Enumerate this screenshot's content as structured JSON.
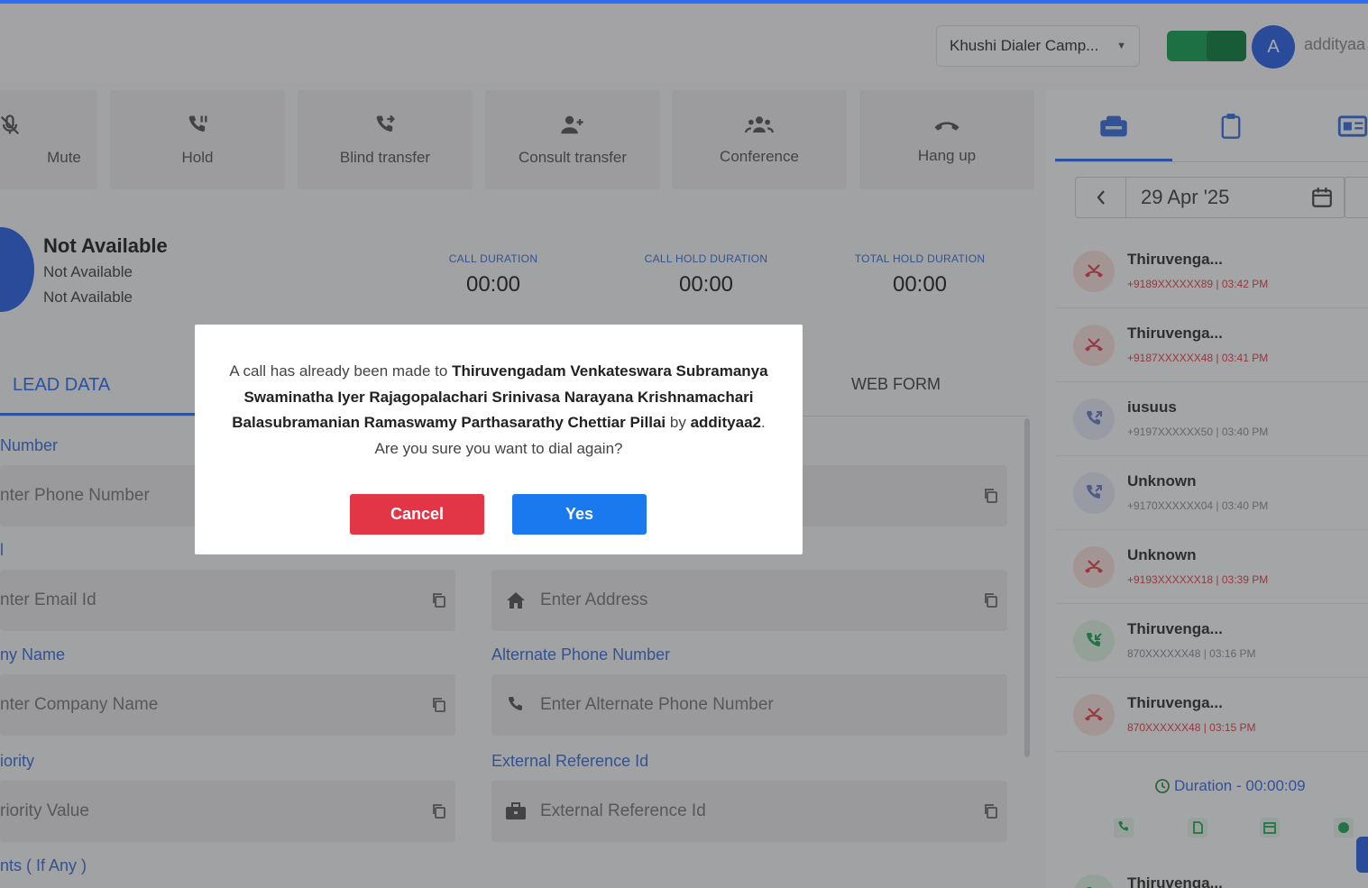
{
  "header": {
    "campaign": "Khushi Dialer Camp...",
    "avatar_letter": "A",
    "username": "addityaa"
  },
  "actions": [
    {
      "label": "Mute",
      "icon": "mic-off-icon"
    },
    {
      "label": "Hold",
      "icon": "phone-paused-icon"
    },
    {
      "label": "Blind transfer",
      "icon": "phone-forward-icon"
    },
    {
      "label": "Consult transfer",
      "icon": "person-add-icon"
    },
    {
      "label": "Conference",
      "icon": "group-icon"
    },
    {
      "label": "Hang up",
      "icon": "hang-up-icon"
    }
  ],
  "status": {
    "title": "Not Available",
    "line1": "Not Available",
    "line2": "Not Available"
  },
  "durations": [
    {
      "label": "CALL DURATION",
      "value": "00:00"
    },
    {
      "label": "CALL HOLD DURATION",
      "value": "00:00"
    },
    {
      "label": "TOTAL HOLD DURATION",
      "value": "00:00"
    }
  ],
  "tabs": {
    "lead_data": "LEAD DATA",
    "web_form": "WEB FORM"
  },
  "form": {
    "left": [
      {
        "label": "Number",
        "placeholder": "nter Phone Number"
      },
      {
        "label": "l",
        "placeholder": "nter Email Id"
      },
      {
        "label": "ny Name",
        "placeholder": "nter Company Name"
      },
      {
        "label": "iority",
        "placeholder": "riority Value"
      }
    ],
    "left_last_label": "nts ( If Any )",
    "right": [
      {
        "label": "",
        "placeholder": ""
      },
      {
        "label": "",
        "placeholder": "Enter Address",
        "icon": "home-icon"
      },
      {
        "label": "Alternate Phone Number",
        "placeholder": "Enter Alternate Phone Number",
        "icon": "phone-icon"
      },
      {
        "label": "External Reference Id",
        "placeholder": "External Reference Id",
        "icon": "briefcase-icon"
      }
    ]
  },
  "right_panel": {
    "date": "29 Apr '25",
    "logs": [
      {
        "name": "Thiruvenga...",
        "sub": "+9189XXXXXX89 | 03:42 PM",
        "type": "missed",
        "color": "#e0434f"
      },
      {
        "name": "Thiruvenga...",
        "sub": "+9187XXXXXX48 | 03:41 PM",
        "type": "missed",
        "color": "#e0434f"
      },
      {
        "name": "iusuus",
        "sub": "+9197XXXXXX50 | 03:40 PM",
        "type": "outgoing",
        "color": "#6b7fc9"
      },
      {
        "name": "Unknown",
        "sub": "+9170XXXXXX04 | 03:40 PM",
        "type": "outgoing",
        "color": "#6b7fc9"
      },
      {
        "name": "Unknown",
        "sub": "+9193XXXXXX18 | 03:39 PM",
        "type": "missed",
        "color": "#e0434f"
      },
      {
        "name": "Thiruvenga...",
        "sub": "870XXXXXX48 | 03:16 PM",
        "type": "answered",
        "color": "#9aa0a8"
      },
      {
        "name": "Thiruvenga...",
        "sub": "870XXXXXX48 | 03:15 PM",
        "type": "missed",
        "color": "#e0434f"
      }
    ],
    "duration": "Duration - 00:00:09",
    "last_log_name": "Thiruvenga..."
  },
  "modal": {
    "prefix": "A call has already been made to ",
    "lead_name": "Thiruvengadam Venkateswara Subramanya Swaminatha Iyer Rajagopalachari Srinivasa Narayana Krishnamachari Balasubramanian Ramaswamy Parthasarathy Chettiar Pillai",
    "mid": " by ",
    "agent": "addityaa2",
    "suffix": ". Are you sure you want to dial again?",
    "cancel_label": "Cancel",
    "yes_label": "Yes"
  }
}
